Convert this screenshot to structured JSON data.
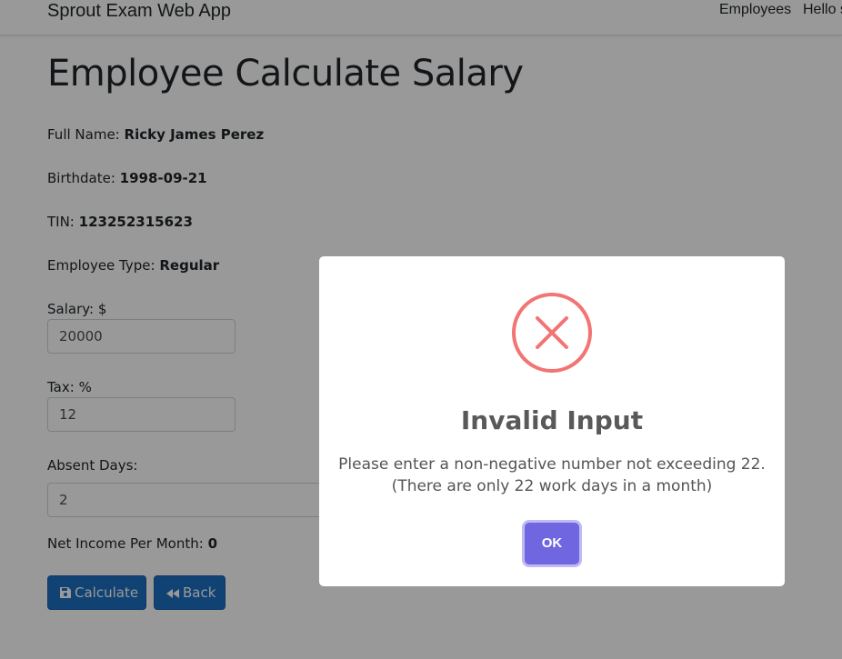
{
  "navbar": {
    "brand": "Sprout Exam Web App",
    "links": [
      "Employees",
      "Hello s"
    ]
  },
  "page": {
    "title": "Employee Calculate Salary",
    "full_name_label": "Full Name:",
    "full_name": "Ricky James Perez",
    "birthdate_label": "Birthdate:",
    "birthdate": "1998-09-21",
    "tin_label": "TIN:",
    "tin": "123252315623",
    "employee_type_label": "Employee Type:",
    "employee_type": "Regular",
    "salary_label": "Salary: $",
    "salary_value": "20000",
    "tax_label": "Tax: %",
    "tax_value": "12",
    "absent_label": "Absent Days:",
    "absent_value": "2",
    "net_income_label": "Net Income Per Month:",
    "net_income": "0",
    "calculate_label": "Calculate",
    "back_label": "Back"
  },
  "modal": {
    "icon": "error-x-icon",
    "title": "Invalid Input",
    "line1": "Please enter a non-negative number not exceeding 22.",
    "line2": "(There are only 22 work days in a month)",
    "ok_label": "OK"
  },
  "colors": {
    "primary_button": "#1b6ec2",
    "error_icon": "#f27474",
    "confirm_button": "#7066e0"
  }
}
